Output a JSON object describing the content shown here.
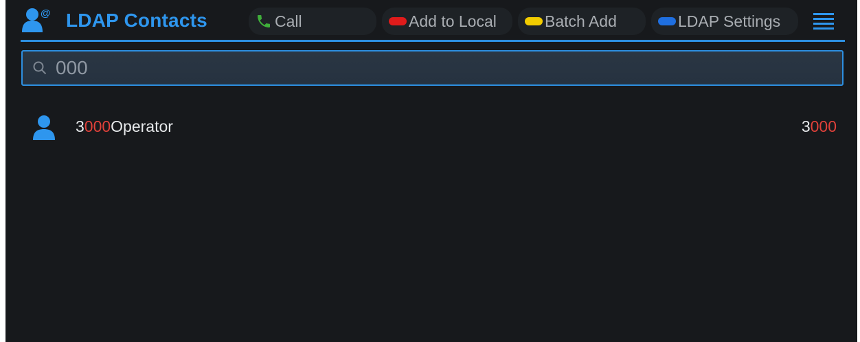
{
  "header": {
    "title": "LDAP Contacts",
    "softkeys": {
      "call": "Call",
      "add_to_local": "Add to Local",
      "batch_add": "Batch Add",
      "ldap_settings": "LDAP Settings"
    }
  },
  "search": {
    "value": "000"
  },
  "contacts": [
    {
      "name_before": "3",
      "name_match": "000",
      "name_after": "Operator",
      "number_before": "3",
      "number_match": "000"
    }
  ],
  "colors": {
    "accent": "#2e96ee",
    "call": "#3fae3a",
    "add_to_local": "#e01b1b",
    "batch_add": "#f2cc00",
    "ldap_settings": "#1f6fe0",
    "match_highlight": "#e0413a"
  },
  "icons": {
    "app": "ldap-contact-icon",
    "call": "phone-icon",
    "menu": "menu-lines-icon",
    "search": "search-icon",
    "avatar": "person-icon"
  }
}
